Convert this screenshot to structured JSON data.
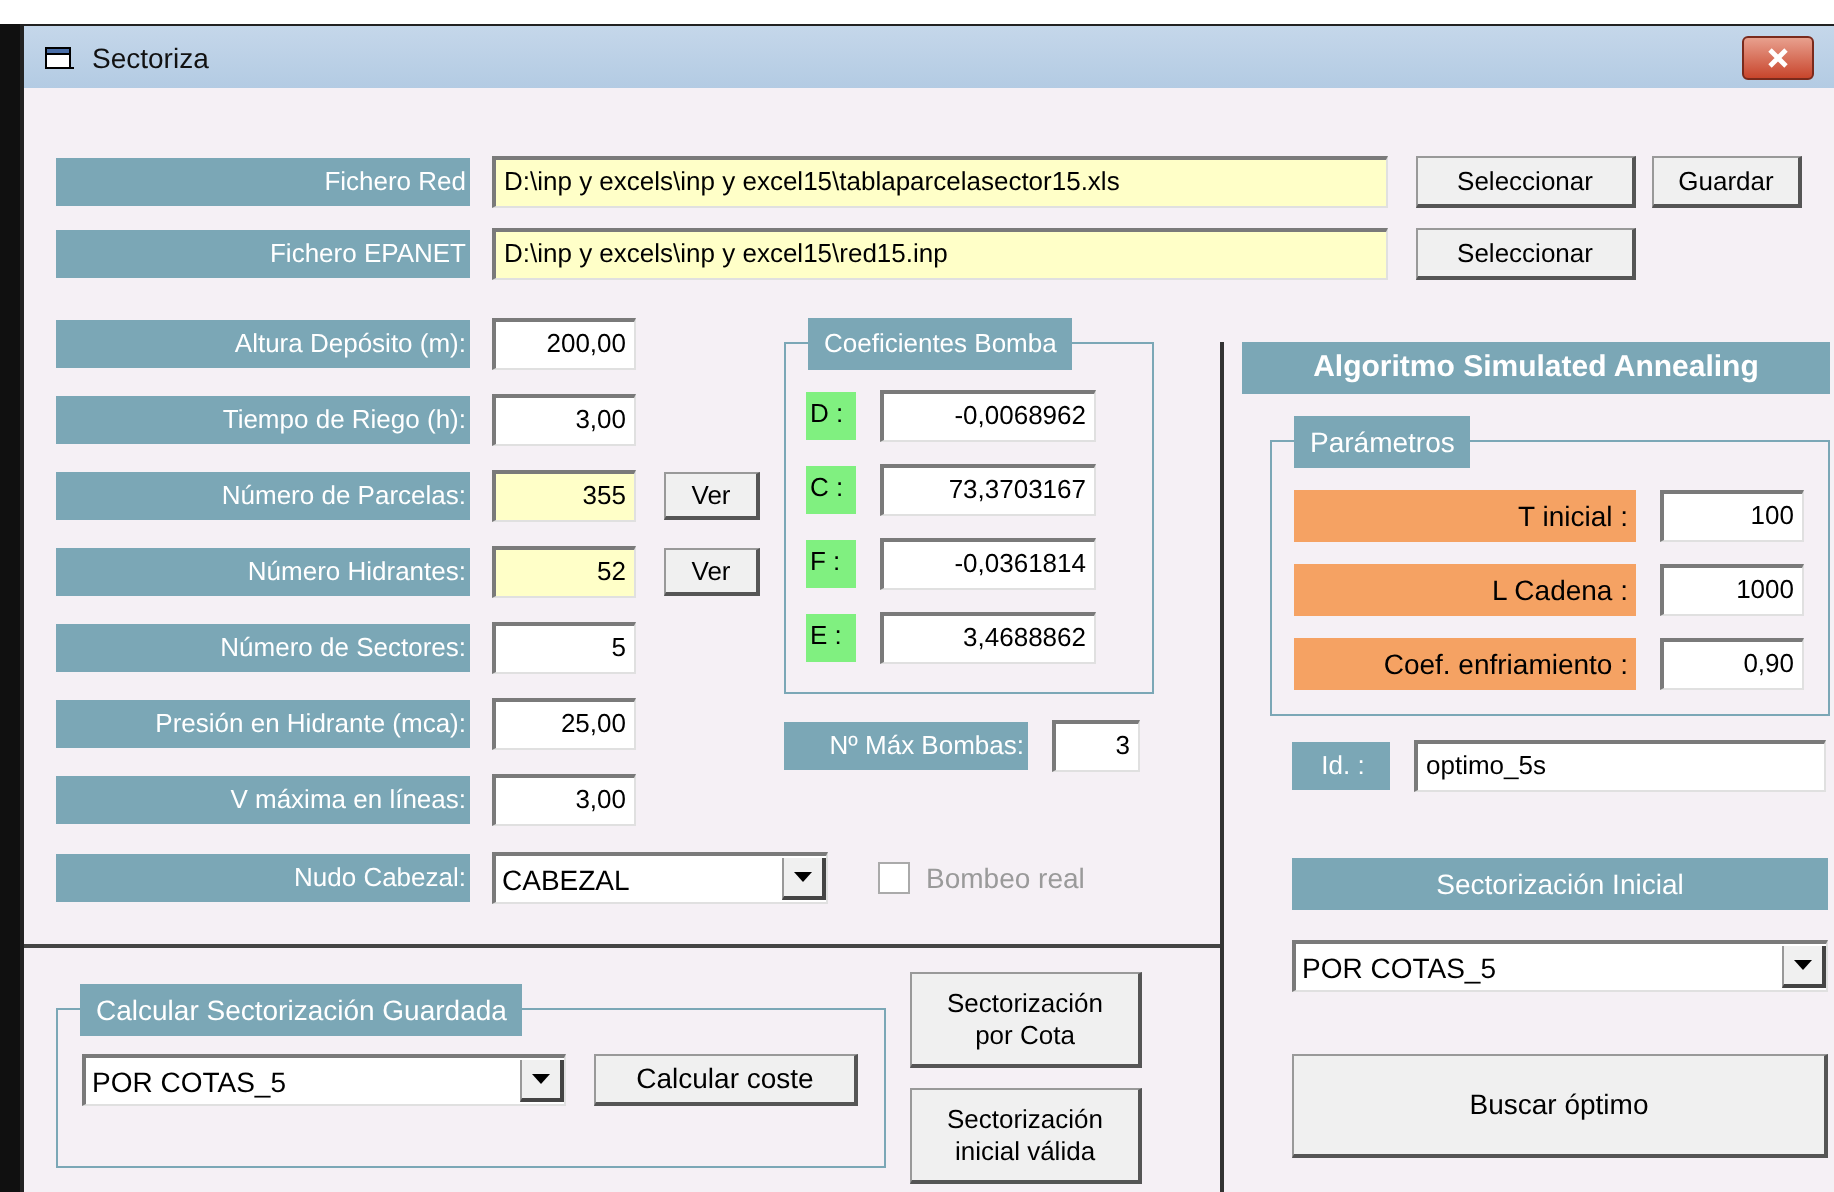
{
  "window": {
    "title": "Sectoriza"
  },
  "files": [
    {
      "label": "Fichero Red",
      "value": "D:\\inp y excels\\inp y excel15\\tablaparcelasector15.xls",
      "buttons": [
        "Seleccionar",
        "Guardar"
      ]
    },
    {
      "label": "Fichero EPANET",
      "value": "D:\\inp y excels\\inp y excel15\\red15.inp",
      "buttons": [
        "Seleccionar"
      ]
    }
  ],
  "parameters": [
    {
      "label": "Altura Depósito (m):",
      "value": "200,00",
      "highlighted": false
    },
    {
      "label": "Tiempo de Riego (h):",
      "value": "3,00",
      "highlighted": false
    },
    {
      "label": "Número de Parcelas:",
      "value": "355",
      "highlighted": true,
      "button": "Ver"
    },
    {
      "label": "Número Hidrantes:",
      "value": "52",
      "highlighted": true,
      "button": "Ver"
    },
    {
      "label": "Número de Sectores:",
      "value": "5",
      "highlighted": false
    },
    {
      "label": "Presión en Hidrante (mca):",
      "value": "25,00",
      "highlighted": false
    },
    {
      "label": "V máxima en líneas:",
      "value": "3,00",
      "highlighted": false
    }
  ],
  "head_node": {
    "label": "Nudo Cabezal:",
    "value": "CABEZAL"
  },
  "real_pumping": {
    "label": "Bombeo real",
    "checked": false,
    "disabled": true
  },
  "pump_coefficients": {
    "title": "Coeficientes Bomba",
    "items": [
      {
        "label": "D :",
        "value": "-0,0068962"
      },
      {
        "label": "C :",
        "value": "73,3703167"
      },
      {
        "label": "F :",
        "value": "-0,0361814"
      },
      {
        "label": "E :",
        "value": "3,4688862"
      }
    ]
  },
  "max_pumps": {
    "label": "Nº Máx Bombas:",
    "value": "3"
  },
  "saved_sectorization": {
    "title": "Calcular Sectorización Guardada",
    "value": "POR COTAS_5",
    "button": "Calcular coste"
  },
  "side_buttons": [
    "Sectorización por Cota",
    "Sectorización inicial válida"
  ],
  "annealing": {
    "title": "Algoritmo Simulated Annealing",
    "parameters_title": "Parámetros",
    "parameters": [
      {
        "label": "T inicial :",
        "value": "100"
      },
      {
        "label": "L Cadena :",
        "value": "1000"
      },
      {
        "label": "Coef. enfriamiento :",
        "value": "0,90"
      }
    ],
    "id": {
      "label": "Id. :",
      "value": "optimo_5s"
    },
    "initial_title": "Sectorización Inicial",
    "initial_value": "POR COTAS_5",
    "button": "Buscar óptimo"
  }
}
